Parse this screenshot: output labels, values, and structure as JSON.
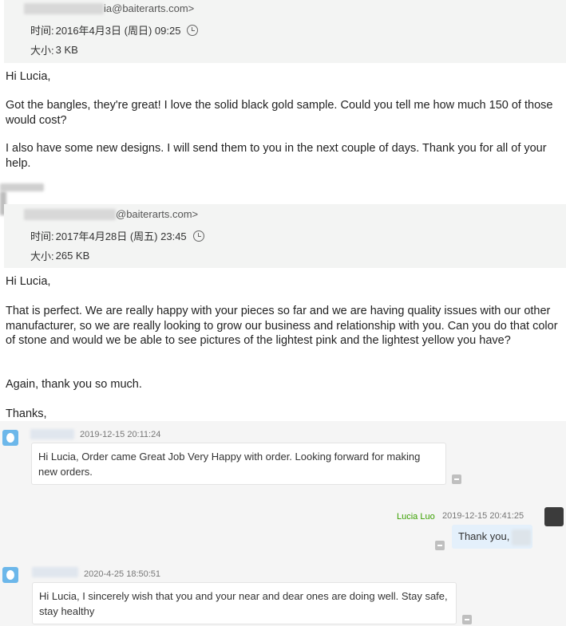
{
  "email1": {
    "sender": "ia@baiterarts.com>",
    "time_label": "时间:",
    "time_value": "2016年4月3日 (周日) 09:25",
    "size_label": "大小:",
    "size_value": "3 KB",
    "paragraphs": [
      "Hi Lucia,",
      "Got the bangles, they're great! I love the solid black gold sample. Could you tell me how much 150 of those would cost?",
      "I also have some new designs. I will send them to you in the next couple of days. Thank you for all of your help."
    ]
  },
  "email2": {
    "sender": "@baiterarts.com>",
    "time_label": "时间:",
    "time_value": "2017年4月28日 (周五) 23:45",
    "size_label": "大小:",
    "size_value": "265 KB",
    "paragraphs": [
      "Hi Lucia,",
      "That is perfect. We are really happy with your pieces so far and we are having quality issues with our other manufacturer, so we are really looking to grow our business and relationship with you. Can you do that color of stone and would we be able to see pictures of the lightest pink and the lightest yellow you have?",
      "Again, thank you so much.",
      "Thanks,"
    ]
  },
  "chat": {
    "messages": [
      {
        "time": "2019-12-15 20:11:24",
        "text": "Hi Lucia, Order came Great Job Very Happy with order. Looking forward for making new orders."
      },
      {
        "sender": "Lucia Luo",
        "time": "2019-12-15 20:41:25",
        "text": "Thank you,"
      },
      {
        "time": "2020-4-25 18:50:51",
        "text": "Hi Lucia, I sincerely wish that you and your near and dear ones are doing well. Stay safe, stay healthy"
      }
    ]
  },
  "icons": {
    "history": "history-icon",
    "avatar": "customer-avatar",
    "status": "message-status-icon"
  },
  "colors": {
    "header_bg": "#f3f4f3",
    "chat_bg": "#f5f5f5",
    "my_bubble": "#e4f0fb",
    "sender_green": "#3aa000",
    "avatar_blue": "#6cb7ea"
  }
}
